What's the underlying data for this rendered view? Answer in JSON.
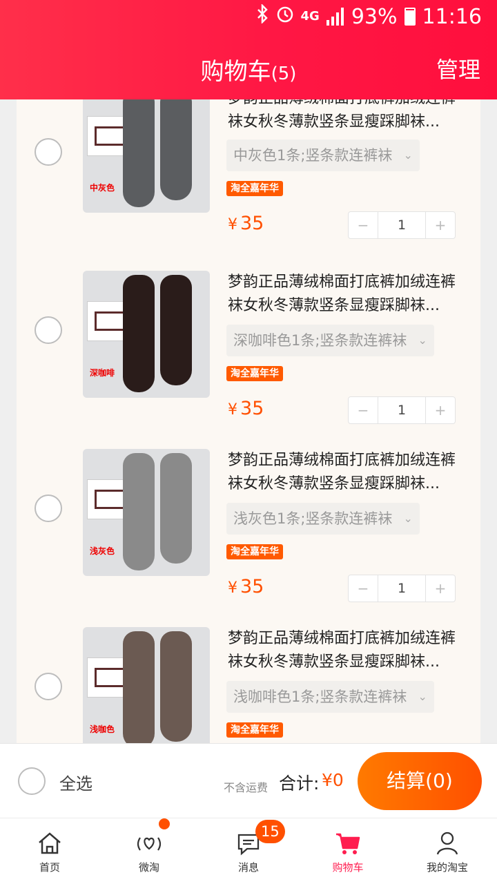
{
  "status_bar": {
    "network": "4G",
    "battery": "93%",
    "time": "11:16"
  },
  "header": {
    "title": "购物车",
    "count": "(5)",
    "manage": "管理"
  },
  "items": [
    {
      "title": "梦韵正品薄绒棉面打底裤加绒连裤袜女秋冬薄款竖条显瘦踩脚袜...",
      "sku": "中灰色1条;竖条款连裤袜",
      "promo": "淘全嘉年华",
      "price_symbol": "¥",
      "price": "35",
      "qty": "1",
      "color_tag": "中灰色",
      "leg_color": "#5b5d60"
    },
    {
      "title": "梦韵正品薄绒棉面打底裤加绒连裤袜女秋冬薄款竖条显瘦踩脚袜...",
      "sku": "深咖啡色1条;竖条款连裤袜",
      "promo": "淘全嘉年华",
      "price_symbol": "¥",
      "price": "35",
      "qty": "1",
      "color_tag": "深咖啡",
      "leg_color": "#2a1c1a"
    },
    {
      "title": "梦韵正品薄绒棉面打底裤加绒连裤袜女秋冬薄款竖条显瘦踩脚袜...",
      "sku": "浅灰色1条;竖条款连裤袜",
      "promo": "淘全嘉年华",
      "price_symbol": "¥",
      "price": "35",
      "qty": "1",
      "color_tag": "浅灰色",
      "leg_color": "#8a8a8a"
    },
    {
      "title": "梦韵正品薄绒棉面打底裤加绒连裤袜女秋冬薄款竖条显瘦踩脚袜...",
      "sku": "浅咖啡色1条;竖条款连裤袜",
      "promo": "淘全嘉年华",
      "price_symbol": "¥",
      "price": "",
      "qty": "",
      "color_tag": "浅咖色",
      "leg_color": "#6b5a52"
    }
  ],
  "checkout": {
    "select_all": "全选",
    "no_shipping": "不含运费",
    "total_label": "合计:",
    "total_value": "¥0",
    "button": "结算(0)"
  },
  "tabs": [
    {
      "label": "首页",
      "icon": "home-icon"
    },
    {
      "label": "微淘",
      "icon": "weitao-icon"
    },
    {
      "label": "消息",
      "icon": "message-icon",
      "badge": "15"
    },
    {
      "label": "购物车",
      "icon": "cart-icon"
    },
    {
      "label": "我的淘宝",
      "icon": "profile-icon"
    }
  ],
  "colors": {
    "header": "#ff1744",
    "accent": "#ff5000",
    "active_tab": "#ff1d4f"
  }
}
